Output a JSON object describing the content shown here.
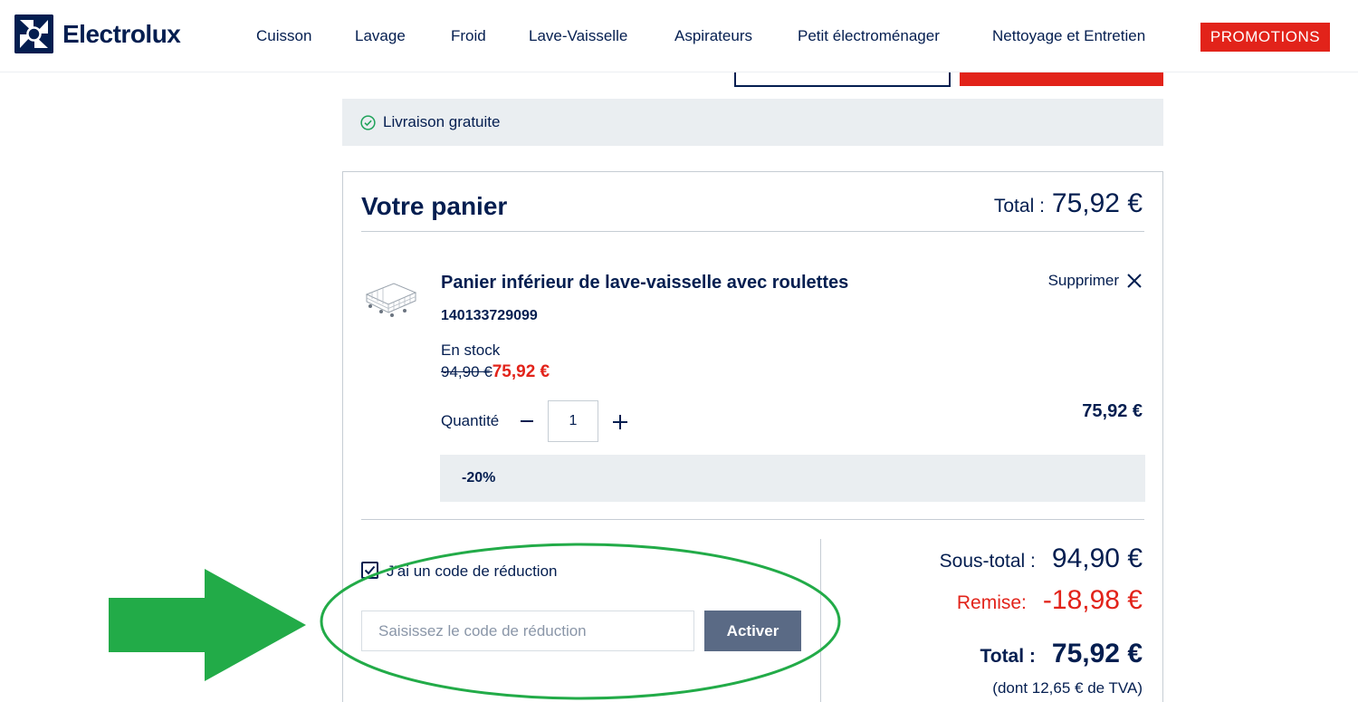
{
  "brand": {
    "name": "Electrolux"
  },
  "nav": {
    "items": [
      {
        "label": "Cuisson"
      },
      {
        "label": "Lavage"
      },
      {
        "label": "Froid"
      },
      {
        "label": "Lave-Vaisselle"
      },
      {
        "label": "Aspirateurs"
      },
      {
        "label": "Petit électroménager"
      },
      {
        "label": "Nettoyage et Entretien"
      }
    ],
    "promo_label": "PROMOTIONS"
  },
  "delivery": {
    "text": "Livraison gratuite"
  },
  "cart": {
    "title": "Votre panier",
    "total_label": "Total :",
    "total_value": "75,92 €",
    "item": {
      "name": "Panier inférieur de lave-vaisselle avec roulettes",
      "sku": "140133729099",
      "stock": "En stock",
      "old_price": "94,90 €",
      "new_price": "75,92 €",
      "remove_label": "Supprimer",
      "quantity_label": "Quantité",
      "quantity": "1",
      "line_total": "75,92 €",
      "discount_badge": "-20%"
    },
    "coupon": {
      "checkbox_label": "J'ai un code de réduction",
      "checked": true,
      "placeholder": "Saisissez le code de réduction",
      "button_label": "Activer"
    },
    "summary": {
      "subtotal_label": "Sous-total :",
      "subtotal_value": "94,90 €",
      "discount_label": "Remise:",
      "discount_value": "-18,98 €",
      "total_label": "Total :",
      "total_value": "75,92 €",
      "vat_note": "(dont 12,65 € de TVA)"
    }
  },
  "colors": {
    "brand_navy": "#041e50",
    "promo_red": "#e2231a",
    "panel_gray": "#eaeef1",
    "button_slate": "#5a6a85",
    "annotation_green": "#22ab48",
    "success_green": "#1fa35a"
  },
  "icons": [
    "electrolux-logo-icon",
    "check-circle-icon",
    "close-icon",
    "minus-icon",
    "plus-icon",
    "checkbox-checked-icon"
  ]
}
